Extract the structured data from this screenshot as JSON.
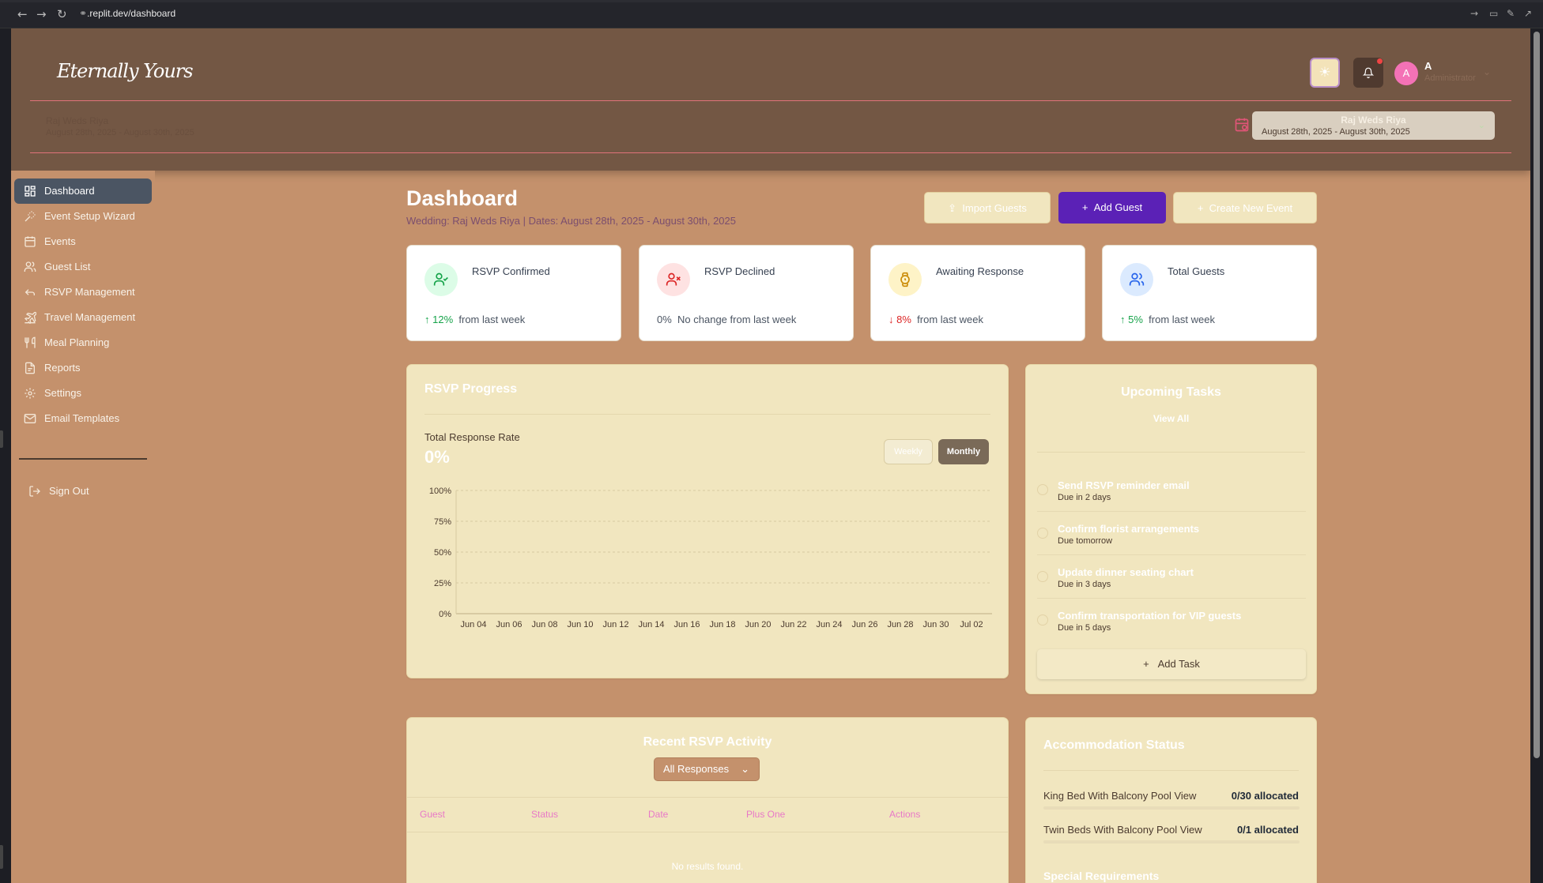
{
  "browser": {
    "url_host": ".replit.dev",
    "url_path": "/dashboard"
  },
  "header": {
    "logo": "Eternally Yours",
    "user_initial": "A",
    "user_name": "A",
    "user_role": "Administrator",
    "event_name": "Raj Weds Riya",
    "event_dates": "August 28th, 2025 - August 30th, 2025",
    "selector_name": "Raj Weds Riya",
    "selector_dates": "August 28th, 2025 - August 30th, 2025"
  },
  "sidebar": {
    "items": [
      {
        "label": "Dashboard",
        "icon": "dashboard-icon"
      },
      {
        "label": "Event Setup Wizard",
        "icon": "wand-icon"
      },
      {
        "label": "Events",
        "icon": "calendar-icon"
      },
      {
        "label": "Guest List",
        "icon": "users-icon"
      },
      {
        "label": "RSVP Management",
        "icon": "reply-icon"
      },
      {
        "label": "Travel Management",
        "icon": "plane-icon"
      },
      {
        "label": "Meal Planning",
        "icon": "utensils-icon"
      },
      {
        "label": "Reports",
        "icon": "report-icon"
      },
      {
        "label": "Settings",
        "icon": "gear-icon"
      },
      {
        "label": "Email Templates",
        "icon": "mail-icon"
      }
    ],
    "sign_out": "Sign Out"
  },
  "main": {
    "title": "Dashboard",
    "subtitle": "Wedding: Raj Weds Riya | Dates: August 28th, 2025 - August 30th, 2025",
    "buttons": {
      "import": "Import Guests",
      "add": "Add Guest",
      "create": "Create New Event"
    },
    "stats": [
      {
        "title": "RSVP Confirmed",
        "pct": "12%",
        "trend": "up",
        "text": "from last week",
        "color": "#16a34a"
      },
      {
        "title": "RSVP Declined",
        "pct": "0%",
        "trend": "none",
        "text": "No change from last week",
        "color": "#dc2626"
      },
      {
        "title": "Awaiting Response",
        "pct": "8%",
        "trend": "down",
        "text": "from last week",
        "color": "#ca8a04"
      },
      {
        "title": "Total Guests",
        "pct": "5%",
        "trend": "up",
        "text": "from last week",
        "color": "#2563eb"
      }
    ]
  },
  "rsvp_progress": {
    "title": "RSVP Progress",
    "rate_label": "Total Response Rate",
    "rate_value": "0%",
    "toggle_weekly": "Weekly",
    "toggle_monthly": "Monthly"
  },
  "chart_data": {
    "type": "line",
    "categories": [
      "Jun 04",
      "Jun 06",
      "Jun 08",
      "Jun 10",
      "Jun 12",
      "Jun 14",
      "Jun 16",
      "Jun 18",
      "Jun 20",
      "Jun 22",
      "Jun 24",
      "Jun 26",
      "Jun 28",
      "Jun 30",
      "Jul 02"
    ],
    "yticks": [
      "0%",
      "25%",
      "50%",
      "75%",
      "100%"
    ],
    "ylim": [
      0,
      100
    ],
    "series": [],
    "grid": true
  },
  "tasks": {
    "title": "Upcoming Tasks",
    "view_all": "View All",
    "items": [
      {
        "title": "Send RSVP reminder email",
        "due": "Due in 2 days"
      },
      {
        "title": "Confirm florist arrangements",
        "due": "Due tomorrow"
      },
      {
        "title": "Update dinner seating chart",
        "due": "Due in 3 days"
      },
      {
        "title": "Confirm transportation for VIP guests",
        "due": "Due in 5 days"
      }
    ],
    "add_label": "Add Task"
  },
  "activity": {
    "title": "Recent RSVP Activity",
    "filter": "All Responses",
    "columns": [
      "Guest",
      "Status",
      "Date",
      "Plus One",
      "Actions"
    ],
    "empty": "No results found."
  },
  "accommodation": {
    "title": "Accommodation Status",
    "rooms": [
      {
        "label": "King Bed With Balcony Pool View",
        "value": "0/30 allocated",
        "fraction": 0
      },
      {
        "label": "Twin Beds With Balcony Pool View",
        "value": "0/1 allocated",
        "fraction": 0
      }
    ],
    "special_title": "Special Requirements"
  }
}
